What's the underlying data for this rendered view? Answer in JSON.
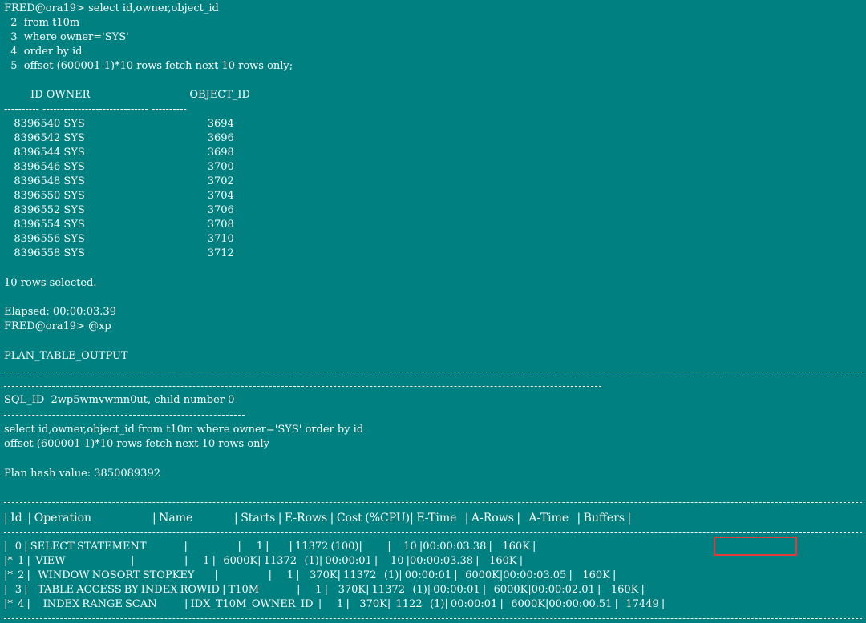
{
  "query": {
    "lines": [
      "FRED@ora19> select id,owner,object_id",
      "  2  from t10m",
      "  3  where owner='SYS'",
      "  4  order by id",
      "  5  offset (600001-1)*10 rows fetch next 10 rows only;"
    ]
  },
  "result": {
    "header": "        ID OWNER                              OBJECT_ID",
    "separator": "---------- ------------------------------ ----------",
    "rows": [
      "   8396540 SYS                                     3694",
      "   8396542 SYS                                     3696",
      "   8396544 SYS                                     3698",
      "   8396546 SYS                                     3700",
      "   8396548 SYS                                     3702",
      "   8396550 SYS                                     3704",
      "   8396552 SYS                                     3706",
      "   8396554 SYS                                     3708",
      "   8396556 SYS                                     3710",
      "   8396558 SYS                                     3712"
    ],
    "rows_selected": "10 rows selected.",
    "elapsed": "Elapsed: 00:00:03.39",
    "next_prompt": "FRED@ora19> @xp"
  },
  "plan": {
    "title": "PLAN_TABLE_OUTPUT",
    "sql_id_line": "SQL_ID  2wp5wmvwmn0ut, child number 0",
    "sql_text": [
      "select id,owner,object_id from t10m where owner='SYS' order by id",
      "offset (600001-1)*10 rows fetch next 10 rows only"
    ],
    "hash_line": "Plan hash value: 3850089392",
    "table_header": "| Id  | Operation                      | Name               | Starts | E-Rows | Cost (%CPU)| E-Time   | A-Rows |   A-Time   | Buffers |",
    "table_rows": [
      "|   0 | SELECT STATEMENT               |                    |      1 |        | 11372 (100)|          |     10 |00:00:03.38 |    160K |",
      "|*  1 |  VIEW                          |                    |      1 |   6000K| 11372   (1)| 00:00:01 |     10 |00:00:03.38 |    160K |",
      "|*  2 |   WINDOW NOSORT STOPKEY        |                    |      1 |    370K| 11372   (1)| 00:00:01 |   6000K|00:00:03.05 |    160K |",
      "|   3 |    TABLE ACCESS BY INDEX ROWID | T10M               |      1 |    370K| 11372   (1)| 00:00:01 |   6000K|00:00:02.01 |    160K |",
      "|*  4 |     INDEX RANGE SCAN           | IDX_T10M_OWNER_ID  |      1 |    370K|  1122   (1)| 00:00:01 |   6000K|00:00:00.51 |   17449 |"
    ]
  },
  "colors": {
    "background": "#008080",
    "text": "#ffffff",
    "highlight": "#e03a3a"
  }
}
